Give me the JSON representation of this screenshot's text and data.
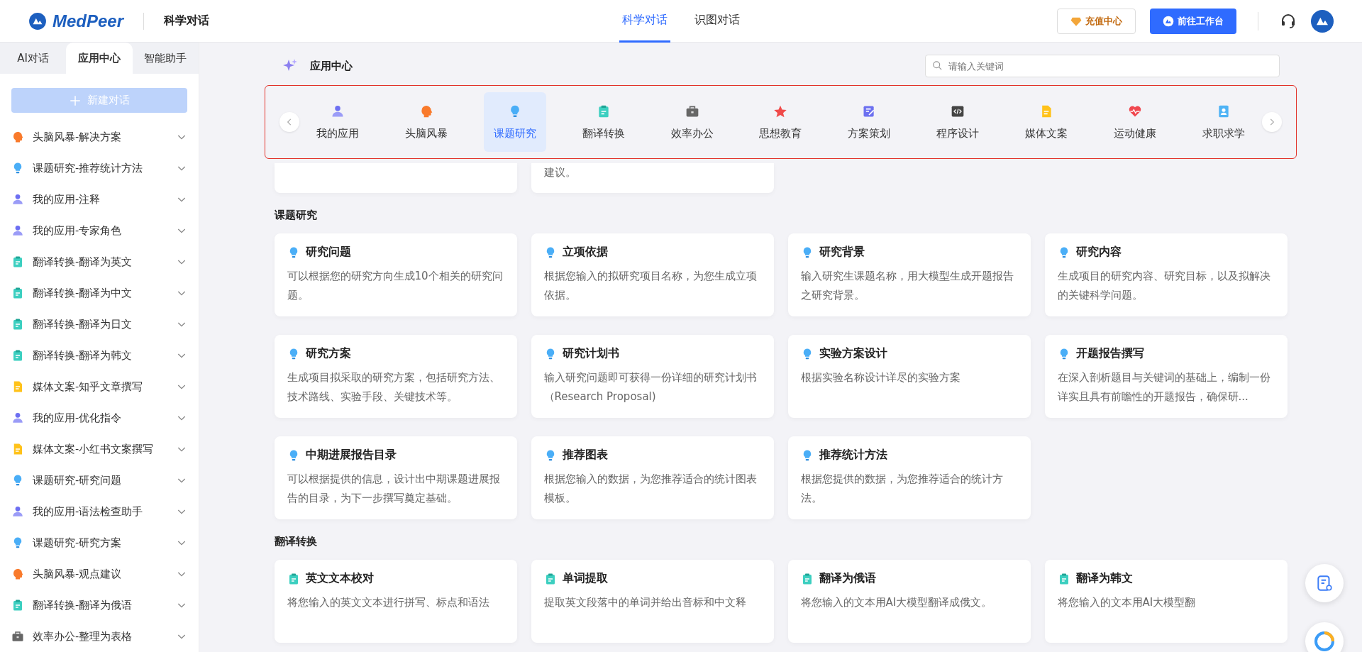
{
  "header": {
    "logo": "MedPeer",
    "product": "科学对话",
    "tabs": [
      {
        "label": "科学对话",
        "selected": true
      },
      {
        "label": "识图对话",
        "selected": false
      }
    ],
    "recharge_button": "充值中心",
    "workbench_button": "前往工作台"
  },
  "sidebar": {
    "tabs": [
      {
        "label": "AI对话",
        "selected": false
      },
      {
        "label": "应用中心",
        "selected": true
      },
      {
        "label": "智能助手",
        "selected": false
      }
    ],
    "new_chat_button": "新建对话",
    "items": [
      {
        "kind": "brain",
        "label": "头脑风暴-解决方案"
      },
      {
        "kind": "bulb",
        "label": "课题研究-推荐统计方法"
      },
      {
        "kind": "user",
        "label": "我的应用-注释"
      },
      {
        "kind": "user",
        "label": "我的应用-专家角色"
      },
      {
        "kind": "clipboard",
        "label": "翻译转换-翻译为英文"
      },
      {
        "kind": "clipboard",
        "label": "翻译转换-翻译为中文"
      },
      {
        "kind": "clipboard",
        "label": "翻译转换-翻译为日文"
      },
      {
        "kind": "clipboard",
        "label": "翻译转换-翻译为韩文"
      },
      {
        "kind": "doc",
        "label": "媒体文案-知乎文章撰写"
      },
      {
        "kind": "user",
        "label": "我的应用-优化指令"
      },
      {
        "kind": "doc",
        "label": "媒体文案-小红书文案撰写"
      },
      {
        "kind": "bulb",
        "label": "课题研究-研究问题"
      },
      {
        "kind": "user",
        "label": "我的应用-语法检查助手"
      },
      {
        "kind": "bulb",
        "label": "课题研究-研究方案"
      },
      {
        "kind": "brain",
        "label": "头脑风暴-观点建议"
      },
      {
        "kind": "clipboard",
        "label": "翻译转换-翻译为俄语"
      },
      {
        "kind": "briefcase",
        "label": "效率办公-整理为表格"
      }
    ]
  },
  "app_center": {
    "title": "应用中心",
    "search": {
      "placeholder": "请输入关键词"
    },
    "categories": [
      {
        "kind": "user",
        "label": "我的应用",
        "selected": false
      },
      {
        "kind": "brain",
        "label": "头脑风暴",
        "selected": false
      },
      {
        "kind": "bulb",
        "label": "课题研究",
        "selected": true
      },
      {
        "kind": "clipboard",
        "label": "翻译转换",
        "selected": false
      },
      {
        "kind": "briefcase",
        "label": "效率办公",
        "selected": false
      },
      {
        "kind": "star",
        "label": "思想教育",
        "selected": false
      },
      {
        "kind": "edit",
        "label": "方案策划",
        "selected": false
      },
      {
        "kind": "code",
        "label": "程序设计",
        "selected": false
      },
      {
        "kind": "doc",
        "label": "媒体文案",
        "selected": false
      },
      {
        "kind": "heart",
        "label": "运动健康",
        "selected": false
      },
      {
        "kind": "idcard",
        "label": "求职求学",
        "selected": false
      }
    ]
  },
  "partial_cards": [
    {
      "kind": "blank"
    },
    {
      "kind": "text",
      "text_tail": "建议。"
    }
  ],
  "sections": [
    {
      "title": "课题研究",
      "kind": "research",
      "cards": [
        {
          "title": "研究问题",
          "description": "可以根据您的研究方向生成10个相关的研究问题。"
        },
        {
          "title": "立项依据",
          "description": "根据您输入的拟研究项目名称，为您生成立项依据。"
        },
        {
          "title": "研究背景",
          "description": "输入研究生课题名称，用大模型生成开题报告之研究背景。"
        },
        {
          "title": "研究内容",
          "description": "生成项目的研究内容、研究目标，以及拟解决的关键科学问题。"
        },
        {
          "title": "研究方案",
          "description": "生成项目拟采取的研究方案，包括研究方法、技术路线、实验手段、关键技术等。"
        },
        {
          "title": "研究计划书",
          "description": "输入研究问题即可获得一份详细的研究计划书（Research Proposal)"
        },
        {
          "title": "实验方案设计",
          "description": "根据实验名称设计详尽的实验方案"
        },
        {
          "title": "开题报告撰写",
          "description": "在深入剖析题目与关键词的基础上，编制一份详实且具有前瞻性的开题报告，确保研..."
        },
        {
          "title": "中期进展报告目录",
          "description": "可以根据提供的信息，设计出中期课题进展报告的目录，为下一步撰写奠定基础。"
        },
        {
          "title": "推荐图表",
          "description": "根据您输入的数据，为您推荐适合的统计图表模板。"
        },
        {
          "title": "推荐统计方法",
          "description": "根据您提供的数据，为您推荐适合的统计方法。"
        }
      ]
    },
    {
      "title": "翻译转换",
      "kind": "translation",
      "cards": [
        {
          "title": "英文文本校对",
          "description": "将您输入的英文文本进行拼写、标点和语法"
        },
        {
          "title": "单词提取",
          "description": "提取英文段落中的单词并给出音标和中文释"
        },
        {
          "title": "翻译为俄语",
          "description": "将您输入的文本用AI大模型翻译成俄文。"
        },
        {
          "title": "翻译为韩文",
          "description": "将您输入的文本用AI大模型翻"
        }
      ]
    }
  ]
}
